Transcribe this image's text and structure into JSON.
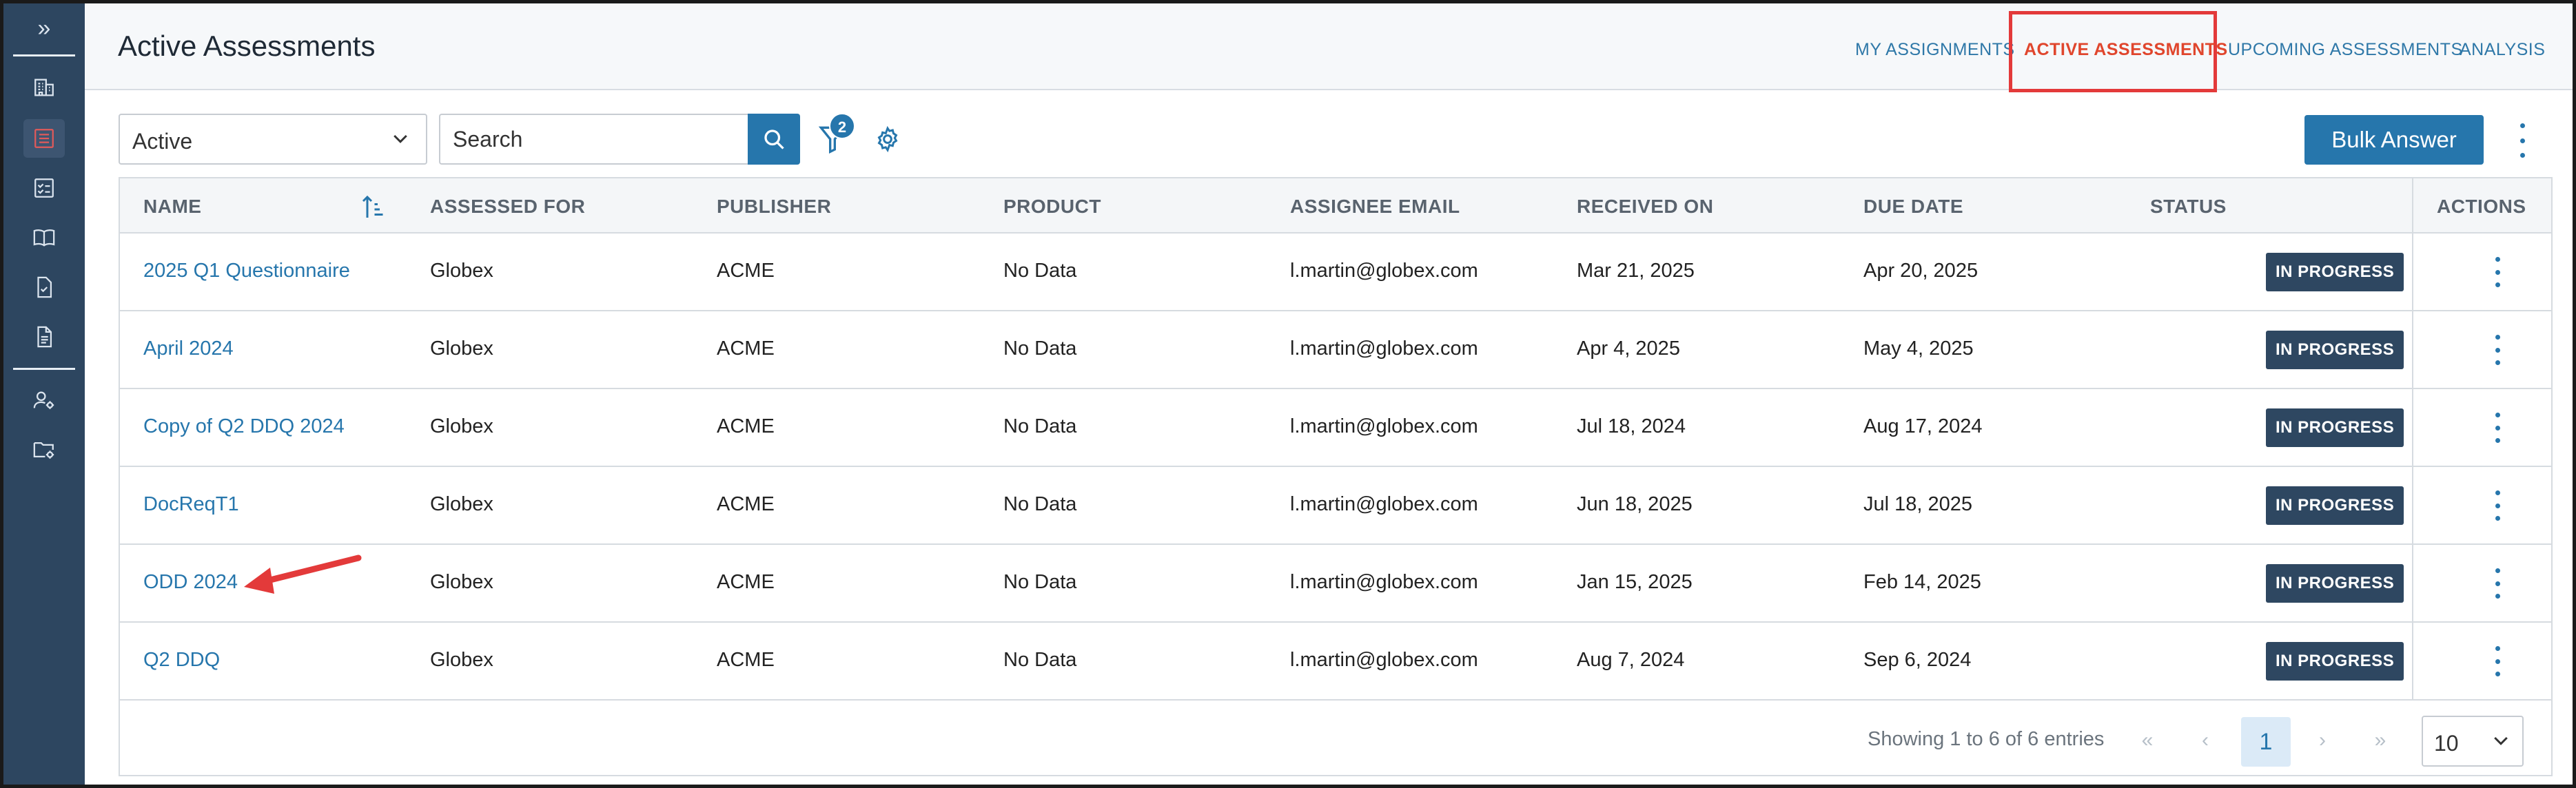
{
  "sidebar": {
    "expand_glyph": "»",
    "items": [
      {
        "icon": "building-icon"
      },
      {
        "icon": "assessment-list-icon",
        "active": true
      },
      {
        "icon": "checklist-icon"
      },
      {
        "icon": "book-icon"
      },
      {
        "icon": "document-check-icon"
      },
      {
        "icon": "document-icon"
      },
      {
        "icon": "user-settings-icon"
      },
      {
        "icon": "folder-settings-icon"
      }
    ]
  },
  "header": {
    "title": "Active Assessments",
    "tabs": [
      {
        "label": "MY ASSIGNMENTS"
      },
      {
        "label": "ACTIVE ASSESSMENTS",
        "active": true
      },
      {
        "label": "UPCOMING ASSESSMENTS"
      },
      {
        "label": "ANALYSIS"
      }
    ]
  },
  "toolbar": {
    "status_select": "Active",
    "search_placeholder": "Search",
    "filter_count": "2",
    "bulk_label": "Bulk Answer"
  },
  "table": {
    "columns": [
      "NAME",
      "ASSESSED FOR",
      "PUBLISHER",
      "PRODUCT",
      "ASSIGNEE EMAIL",
      "RECEIVED ON",
      "DUE DATE",
      "STATUS",
      "ACTIONS"
    ],
    "rows": [
      {
        "name": "2025 Q1 Questionnaire",
        "assessed_for": "Globex",
        "publisher": "ACME",
        "product": "No Data",
        "email": "l.martin@globex.com",
        "received": "Mar 21, 2025",
        "due": "Apr 20, 2025",
        "status": "IN PROGRESS"
      },
      {
        "name": "April 2024",
        "assessed_for": "Globex",
        "publisher": "ACME",
        "product": "No Data",
        "email": "l.martin@globex.com",
        "received": "Apr 4, 2025",
        "due": "May 4, 2025",
        "status": "IN PROGRESS"
      },
      {
        "name": "Copy of Q2 DDQ 2024",
        "assessed_for": "Globex",
        "publisher": "ACME",
        "product": "No Data",
        "email": "l.martin@globex.com",
        "received": "Jul 18, 2024",
        "due": "Aug 17, 2024",
        "status": "IN PROGRESS"
      },
      {
        "name": "DocReqT1",
        "assessed_for": "Globex",
        "publisher": "ACME",
        "product": "No Data",
        "email": "l.martin@globex.com",
        "received": "Jun 18, 2025",
        "due": "Jul 18, 2025",
        "status": "IN PROGRESS"
      },
      {
        "name": "ODD 2024",
        "assessed_for": "Globex",
        "publisher": "ACME",
        "product": "No Data",
        "email": "l.martin@globex.com",
        "received": "Jan 15, 2025",
        "due": "Feb 14, 2025",
        "status": "IN PROGRESS"
      },
      {
        "name": "Q2 DDQ",
        "assessed_for": "Globex",
        "publisher": "ACME",
        "product": "No Data",
        "email": "l.martin@globex.com",
        "received": "Aug 7, 2024",
        "due": "Sep 6, 2024",
        "status": "IN PROGRESS"
      }
    ]
  },
  "pagination": {
    "showing": "Showing 1 to 6 of 6 entries",
    "first": "«",
    "prev": "‹",
    "current": "1",
    "next": "›",
    "last": "»",
    "per_page": "10"
  },
  "colors": {
    "sidebar": "#2d4660",
    "accent": "#2676ac",
    "active_tab": "#e0462d",
    "highlight_box": "#e33a3a",
    "badge": "#2e4761"
  }
}
